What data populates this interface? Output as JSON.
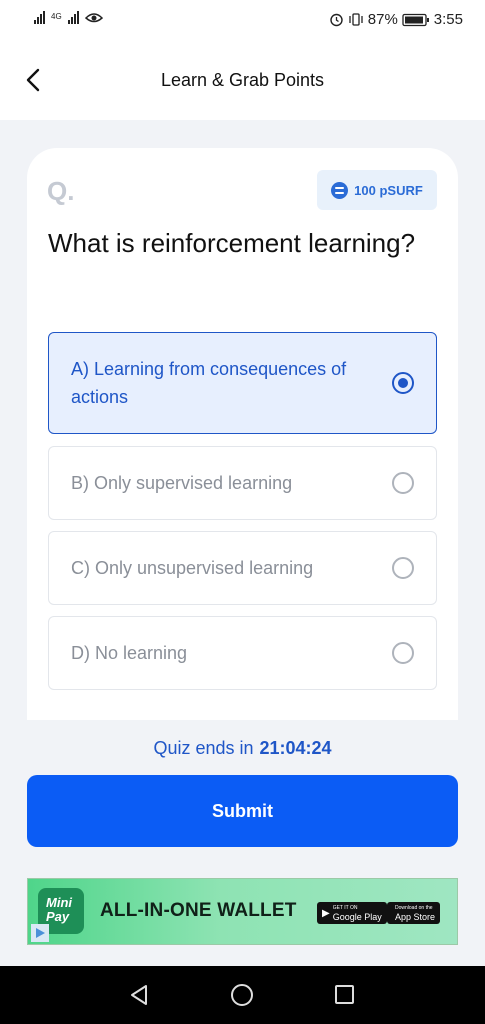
{
  "status_bar": {
    "network": "4G",
    "battery": "87%",
    "time": "3:55"
  },
  "header": {
    "title": "Learn & Grab Points"
  },
  "quiz": {
    "question_marker": "Q.",
    "reward": "100 pSURF",
    "question": "What is reinforcement learning?",
    "options": [
      {
        "label": "A) Learning from consequences of actions",
        "selected": true
      },
      {
        "label": "B) Only supervised learning",
        "selected": false
      },
      {
        "label": "C) Only unsupervised learning",
        "selected": false
      },
      {
        "label": "D) No learning",
        "selected": false
      }
    ],
    "timer_label": "Quiz ends in",
    "timer_value": "21:04:24",
    "submit_label": "Submit"
  },
  "banner": {
    "logo_line1": "Mini",
    "logo_line2": "Pay",
    "headline": "ALL-IN-ONE WALLET",
    "google_play_small": "GET IT ON",
    "google_play": "Google Play",
    "app_store_small": "Download on the",
    "app_store": "App Store"
  },
  "colors": {
    "accent": "#0b5cf5",
    "selected_border": "#1f56c7",
    "selected_bg": "#e7effe",
    "content_bg": "#f1f3f7"
  },
  "icons": [
    "back-arrow-icon",
    "coin-icon",
    "radio-selected-icon",
    "radio-empty-icon",
    "alarm-icon",
    "vibrate-icon",
    "battery-icon",
    "eye-icon",
    "nav-back-icon",
    "nav-home-icon",
    "nav-recents-icon"
  ]
}
